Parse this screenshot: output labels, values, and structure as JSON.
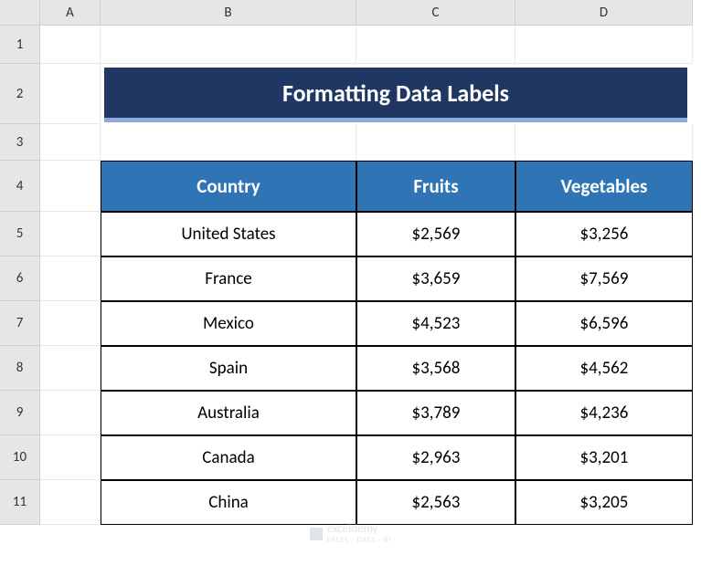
{
  "columns": [
    "A",
    "B",
    "C",
    "D"
  ],
  "rows": [
    "1",
    "2",
    "3",
    "4",
    "5",
    "6",
    "7",
    "8",
    "9",
    "10",
    "11"
  ],
  "title": "Formatting Data Labels",
  "tableHeaders": {
    "country": "Country",
    "fruits": "Fruits",
    "vegetables": "Vegetables"
  },
  "tableData": [
    {
      "country": "United States",
      "fruits": "$2,569",
      "vegetables": "$3,256"
    },
    {
      "country": "France",
      "fruits": "$3,659",
      "vegetables": "$7,569"
    },
    {
      "country": "Mexico",
      "fruits": "$4,523",
      "vegetables": "$6,596"
    },
    {
      "country": "Spain",
      "fruits": "$3,568",
      "vegetables": "$4,562"
    },
    {
      "country": "Australia",
      "fruits": "$3,789",
      "vegetables": "$4,236"
    },
    {
      "country": "Canada",
      "fruits": "$2,963",
      "vegetables": "$3,201"
    },
    {
      "country": "China",
      "fruits": "$2,563",
      "vegetables": "$3,205"
    }
  ],
  "watermark": {
    "brand": "exceldemy",
    "tagline": "EXCEL · DATA · BI"
  }
}
